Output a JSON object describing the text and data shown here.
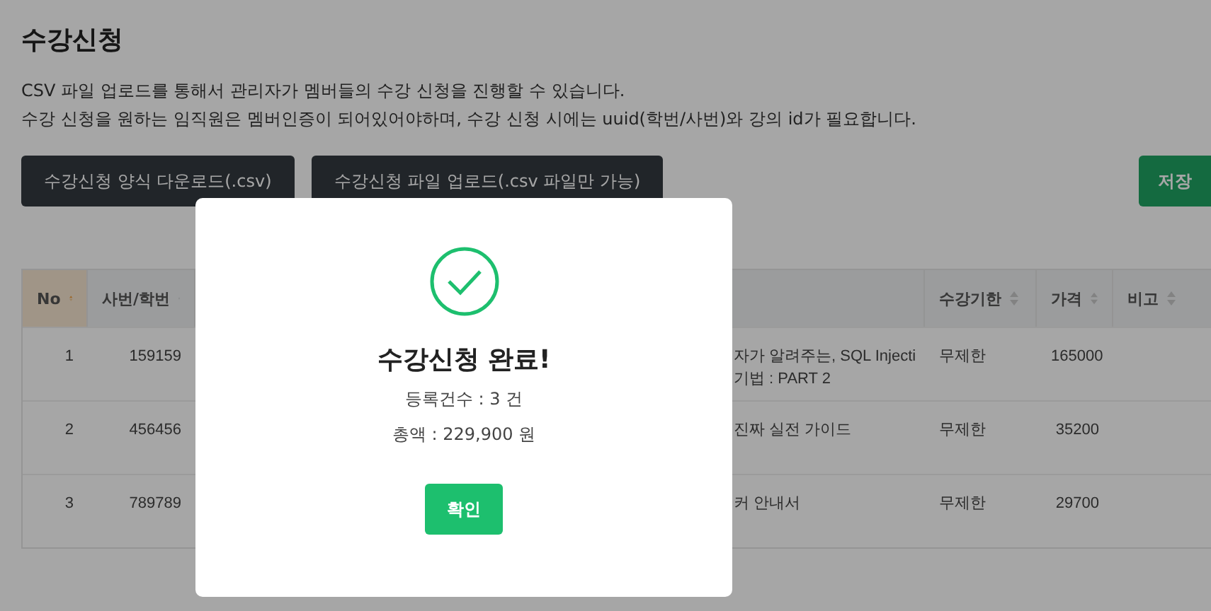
{
  "page": {
    "title": "수강신청",
    "description": [
      "CSV 파일 업로드를 통해서 관리자가 멤버들의 수강 신청을 진행할 수 있습니다.",
      "수강 신청을 원하는 임직원은 멤버인증이 되어있어야하며, 수강 신청 시에는 uuid(학번/사번)와 강의 id가 필요합니다."
    ]
  },
  "toolbar": {
    "buttons": [
      "수강신청 양식 다운로드(.csv)",
      "수강신청 파일 업로드(.csv 파일만 가능)"
    ],
    "save": "저장"
  },
  "table": {
    "columns": [
      {
        "label": "No",
        "sorted": true
      },
      {
        "label": "사번/학번",
        "sorted": false
      },
      {
        "sorted": false
      },
      {
        "label": "수강기한",
        "sorted": false
      },
      {
        "label": "가격",
        "sorted": false
      },
      {
        "label": "비고",
        "sorted": false
      }
    ],
    "rows": [
      {
        "no": "1",
        "id": "159159",
        "course": [
          "자가 알려주는, SQL Injecti",
          "기법 : PART 2"
        ],
        "period": "무제한",
        "price": "165000"
      },
      {
        "no": "2",
        "id": "456456",
        "course": [
          "진짜 실전 가이드"
        ],
        "period": "무제한",
        "price": "35200"
      },
      {
        "no": "3",
        "id": "789789",
        "course": [
          "커 안내서"
        ],
        "period": "무제한",
        "price": "29700"
      }
    ]
  },
  "modal": {
    "title": "수강신청 완료!",
    "lines": [
      "등록건수 : 3 건",
      "총액 : 229,900 원"
    ],
    "button": "확인"
  }
}
